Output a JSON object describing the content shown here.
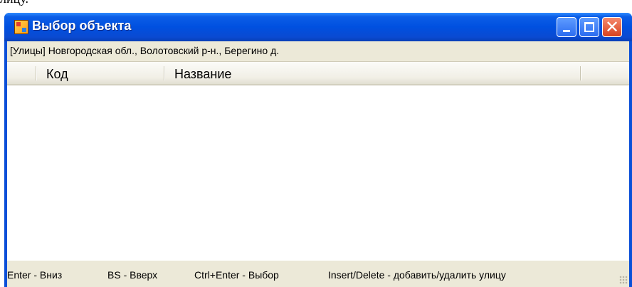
{
  "page_top_text": "лицу.",
  "window": {
    "title": "Выбор объекта",
    "buttons": {
      "minimize": "minimize",
      "maximize": "maximize",
      "close": "✕"
    }
  },
  "info_bar": {
    "text": "[Улицы] Новгородская обл., Волотовский р-н., Берегино д."
  },
  "grid": {
    "columns": [
      "Код",
      "Название"
    ],
    "rows": []
  },
  "status_bar": {
    "items": [
      "Enter - Вниз",
      "BS - Вверх",
      "Ctrl+Enter - Выбор",
      "Insert/Delete - добавить/удалить улицу"
    ]
  },
  "colors": {
    "titlebar": "#0a4fd8",
    "close_button": "#d8421f",
    "client_bg": "#ece9d8"
  }
}
